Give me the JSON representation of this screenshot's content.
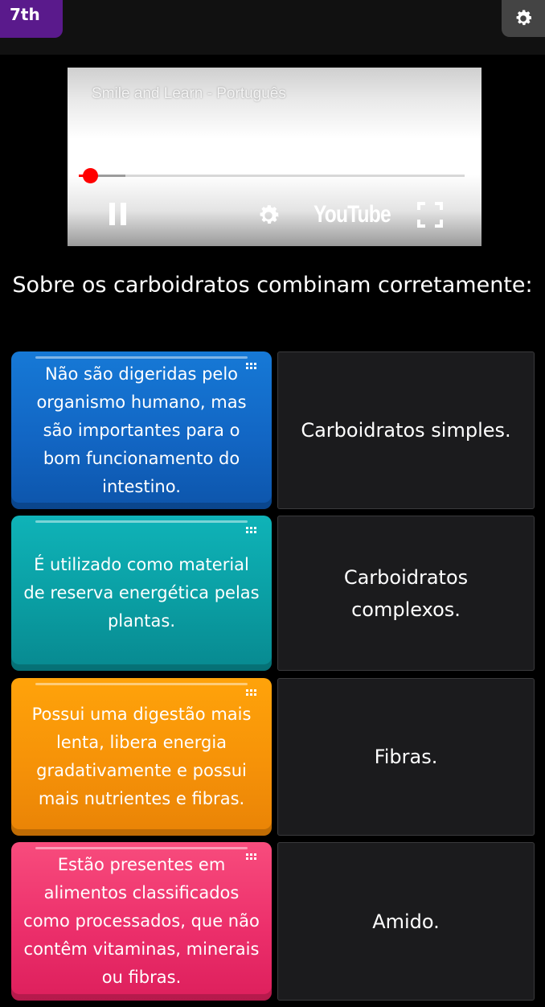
{
  "topbar": {
    "grade_label": "7th",
    "settings_icon": "gear-icon"
  },
  "video": {
    "channel": "Smile and Learn - Português",
    "brand": "YouTube",
    "progress_played": 0.03,
    "progress_loaded": 0.12,
    "icons": [
      "pause-icon",
      "gear-icon",
      "fullscreen-icon"
    ]
  },
  "question": "Sobre os carboidratos combinam corretamente:",
  "pairs": [
    {
      "left": "Não são digeridas pelo organismo humano, mas são importantes para o bom funcionamento do intestino.",
      "right": "Carboidratos simples.",
      "color": "#1266c4"
    },
    {
      "left": "É utilizado como material de reserva energética pelas plantas.",
      "right": "Carboidratos complexos.",
      "color": "#0a9ea3"
    },
    {
      "left": "Possui uma digestão mais lenta, libera energia gradativamente e possui mais nutrientes e fibras.",
      "right": "Fibras.",
      "color": "#f69208"
    },
    {
      "left": "Estão presentes em alimentos classificados como processados, que não contêm vitaminas, minerais ou fibras.",
      "right": "Amido.",
      "color": "#ec2f6b"
    }
  ]
}
